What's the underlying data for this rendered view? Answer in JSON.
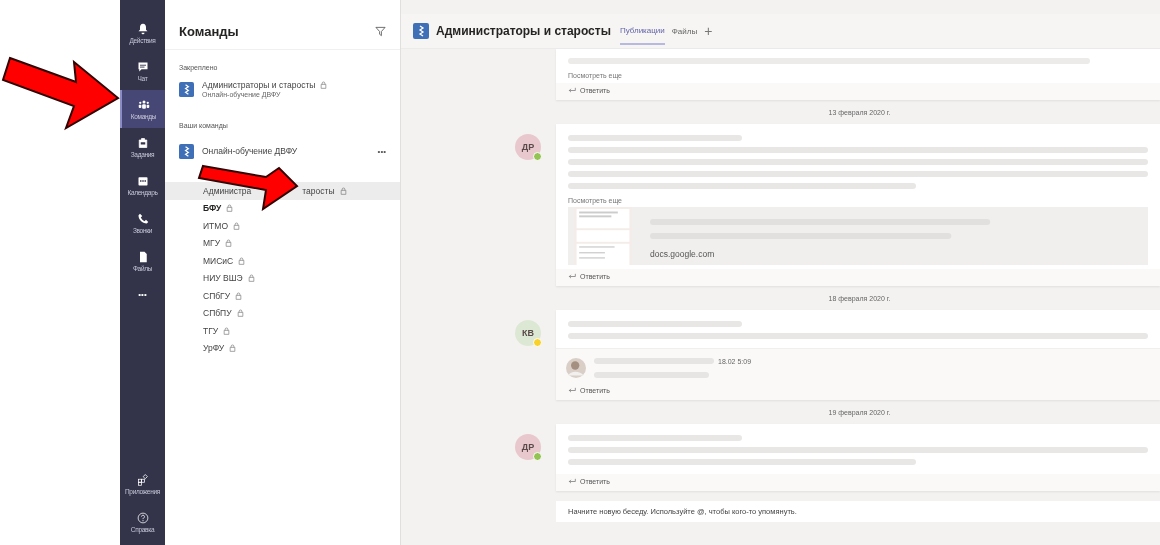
{
  "rail": {
    "items": [
      {
        "label": "Действия",
        "selected": false
      },
      {
        "label": "Чат",
        "selected": false
      },
      {
        "label": "Команды",
        "selected": true
      },
      {
        "label": "Задания",
        "selected": false
      },
      {
        "label": "Календарь",
        "selected": false
      },
      {
        "label": "Звонки",
        "selected": false
      },
      {
        "label": "Файлы",
        "selected": false
      }
    ],
    "more": "•••",
    "bottom": [
      {
        "label": "Приложения"
      },
      {
        "label": "Справка"
      }
    ]
  },
  "teams_panel": {
    "title": "Команды",
    "pinned_label": "Закреплено",
    "pinned": {
      "name": "Администраторы и старосты",
      "team": "Онлайн-обучение ДВФУ"
    },
    "your_label": "Ваши команды",
    "team": {
      "name": "Онлайн-обучение ДВФУ",
      "more": "•••"
    },
    "channels": [
      {
        "name_parts": [
          "Администра",
          "таросты"
        ],
        "selected": true,
        "unread": false
      },
      {
        "name": "БФУ",
        "selected": false,
        "unread": true
      },
      {
        "name": "ИТМО",
        "selected": false,
        "unread": false
      },
      {
        "name": "МГУ",
        "selected": false,
        "unread": false
      },
      {
        "name": "МИСиС",
        "selected": false,
        "unread": false
      },
      {
        "name": "НИУ ВШЭ",
        "selected": false,
        "unread": false
      },
      {
        "name": "СПбГУ",
        "selected": false,
        "unread": false
      },
      {
        "name": "СПбПУ",
        "selected": false,
        "unread": false
      },
      {
        "name": "ТГУ",
        "selected": false,
        "unread": false
      },
      {
        "name": "УрФУ",
        "selected": false,
        "unread": false
      }
    ]
  },
  "header": {
    "title": "Администраторы и старосты",
    "tabs": [
      {
        "label": "Публикации",
        "selected": true
      },
      {
        "label": "Файлы",
        "selected": false
      }
    ],
    "add": "+"
  },
  "feed": [
    {
      "kind": "post",
      "partial": true,
      "show_more": "Посмотреть еще",
      "reply": "Ответить"
    },
    {
      "kind": "date",
      "text": "13 февраля 2020 г."
    },
    {
      "kind": "post",
      "avatar": {
        "initials": "ДР",
        "color": "#e8c8cc"
      },
      "status": {
        "color": "#92c353"
      },
      "show_more": "Посмотреть еще",
      "preview": {
        "domain": "docs.google.com"
      },
      "reply": "Ответить"
    },
    {
      "kind": "date",
      "text": "18 февраля 2020 г."
    },
    {
      "kind": "post",
      "avatar": {
        "initials": "КВ",
        "color": "#dde8d4"
      },
      "status": {
        "color": "#f8d22a"
      },
      "nested": {
        "time": "18.02 5:09"
      },
      "reply": "Ответить"
    },
    {
      "kind": "date",
      "text": "19 февраля 2020 г."
    },
    {
      "kind": "post",
      "avatar": {
        "initials": "ДР",
        "color": "#e8c8cc"
      },
      "status": {
        "color": "#92c353"
      },
      "reply": "Ответить"
    }
  ],
  "compose": {
    "placeholder": "Начните новую беседу. Используйте @, чтобы кого-то упомянуть."
  }
}
